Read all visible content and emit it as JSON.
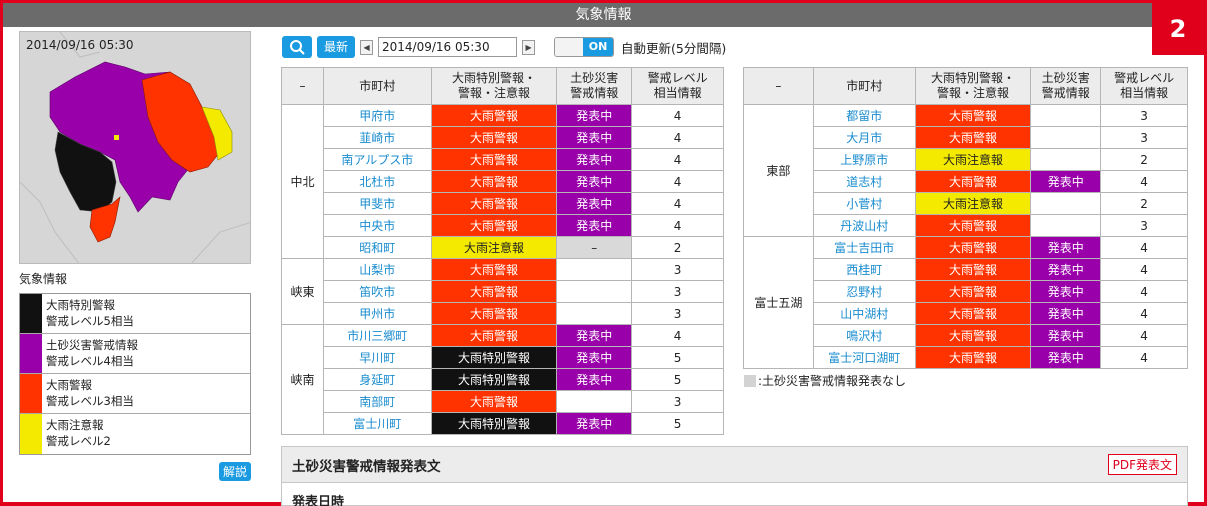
{
  "window": {
    "title": "気象情報",
    "badge": "2"
  },
  "map": {
    "timestamp": "2014/09/16 05:30"
  },
  "left": {
    "heading": "気象情報",
    "legend": [
      {
        "line1": "大雨特別警報",
        "line2": "警戒レベル5相当",
        "color": "#111111"
      },
      {
        "line1": "土砂災害警戒情報",
        "line2": "警戒レベル4相当",
        "color": "#9900aa"
      },
      {
        "line1": "大雨警報",
        "line2": "警戒レベル3相当",
        "color": "#ff3300"
      },
      {
        "line1": "大雨注意報",
        "line2": "警戒レベル2",
        "color": "#f3ea00"
      }
    ],
    "explain_label": "解説"
  },
  "toolbar": {
    "latest_label": "最新",
    "prev_glyph": "◀",
    "next_glyph": "▶",
    "datetime": "2014/09/16  05:30",
    "toggle_label": "ON",
    "auto_update_label": "自動更新(5分間隔)"
  },
  "headers": {
    "dash": "–",
    "city": "市町村",
    "warning_l1": "大雨特別警報・",
    "warning_l2": "警報・注意報",
    "landslide_l1": "土砂災害",
    "landslide_l2": "警戒情報",
    "level_l1": "警戒レベル",
    "level_l2": "相当情報"
  },
  "left_table": {
    "groups": [
      {
        "region": "中北",
        "rows": [
          {
            "city": "甲府市",
            "warning": "大雨警報",
            "wclass": "w-hw",
            "landslide": "発表中",
            "lclass": "l-on",
            "level": "4"
          },
          {
            "city": "韮崎市",
            "warning": "大雨警報",
            "wclass": "w-hw",
            "landslide": "発表中",
            "lclass": "l-on",
            "level": "4"
          },
          {
            "city": "南アルプス市",
            "warning": "大雨警報",
            "wclass": "w-hw",
            "landslide": "発表中",
            "lclass": "l-on",
            "level": "4"
          },
          {
            "city": "北杜市",
            "warning": "大雨警報",
            "wclass": "w-hw",
            "landslide": "発表中",
            "lclass": "l-on",
            "level": "4"
          },
          {
            "city": "甲斐市",
            "warning": "大雨警報",
            "wclass": "w-hw",
            "landslide": "発表中",
            "lclass": "l-on",
            "level": "4"
          },
          {
            "city": "中央市",
            "warning": "大雨警報",
            "wclass": "w-hw",
            "landslide": "発表中",
            "lclass": "l-on",
            "level": "4"
          },
          {
            "city": "昭和町",
            "warning": "大雨注意報",
            "wclass": "w-ad",
            "landslide": "–",
            "lclass": "l-na",
            "level": "2"
          }
        ]
      },
      {
        "region": "峡東",
        "rows": [
          {
            "city": "山梨市",
            "warning": "大雨警報",
            "wclass": "w-hw",
            "landslide": "",
            "lclass": "",
            "level": "3"
          },
          {
            "city": "笛吹市",
            "warning": "大雨警報",
            "wclass": "w-hw",
            "landslide": "",
            "lclass": "",
            "level": "3"
          },
          {
            "city": "甲州市",
            "warning": "大雨警報",
            "wclass": "w-hw",
            "landslide": "",
            "lclass": "",
            "level": "3"
          }
        ]
      },
      {
        "region": "峡南",
        "rows": [
          {
            "city": "市川三郷町",
            "warning": "大雨警報",
            "wclass": "w-hw",
            "landslide": "発表中",
            "lclass": "l-on",
            "level": "4"
          },
          {
            "city": "早川町",
            "warning": "大雨特別警報",
            "wclass": "w-sp",
            "landslide": "発表中",
            "lclass": "l-on",
            "level": "5"
          },
          {
            "city": "身延町",
            "warning": "大雨特別警報",
            "wclass": "w-sp",
            "landslide": "発表中",
            "lclass": "l-on",
            "level": "5"
          },
          {
            "city": "南部町",
            "warning": "大雨警報",
            "wclass": "w-hw",
            "landslide": "",
            "lclass": "",
            "level": "3"
          },
          {
            "city": "富士川町",
            "warning": "大雨特別警報",
            "wclass": "w-sp",
            "landslide": "発表中",
            "lclass": "l-on",
            "level": "5"
          }
        ]
      }
    ]
  },
  "right_table": {
    "groups": [
      {
        "region": "東部",
        "rows": [
          {
            "city": "都留市",
            "warning": "大雨警報",
            "wclass": "w-hw",
            "landslide": "",
            "lclass": "",
            "level": "3"
          },
          {
            "city": "大月市",
            "warning": "大雨警報",
            "wclass": "w-hw",
            "landslide": "",
            "lclass": "",
            "level": "3"
          },
          {
            "city": "上野原市",
            "warning": "大雨注意報",
            "wclass": "w-ad",
            "landslide": "",
            "lclass": "",
            "level": "2"
          },
          {
            "city": "道志村",
            "warning": "大雨警報",
            "wclass": "w-hw",
            "landslide": "発表中",
            "lclass": "l-on",
            "level": "4"
          },
          {
            "city": "小菅村",
            "warning": "大雨注意報",
            "wclass": "w-ad",
            "landslide": "",
            "lclass": "",
            "level": "2"
          },
          {
            "city": "丹波山村",
            "warning": "大雨警報",
            "wclass": "w-hw",
            "landslide": "",
            "lclass": "",
            "level": "3"
          }
        ]
      },
      {
        "region": "富士五湖",
        "rows": [
          {
            "city": "富士吉田市",
            "warning": "大雨警報",
            "wclass": "w-hw",
            "landslide": "発表中",
            "lclass": "l-on",
            "level": "4"
          },
          {
            "city": "西桂町",
            "warning": "大雨警報",
            "wclass": "w-hw",
            "landslide": "発表中",
            "lclass": "l-on",
            "level": "4"
          },
          {
            "city": "忍野村",
            "warning": "大雨警報",
            "wclass": "w-hw",
            "landslide": "発表中",
            "lclass": "l-on",
            "level": "4"
          },
          {
            "city": "山中湖村",
            "warning": "大雨警報",
            "wclass": "w-hw",
            "landslide": "発表中",
            "lclass": "l-on",
            "level": "4"
          },
          {
            "city": "鳴沢村",
            "warning": "大雨警報",
            "wclass": "w-hw",
            "landslide": "発表中",
            "lclass": "l-on",
            "level": "4"
          },
          {
            "city": "富士河口湖町",
            "warning": "大雨警報",
            "wclass": "w-hw",
            "landslide": "発表中",
            "lclass": "l-on",
            "level": "4"
          }
        ]
      }
    ]
  },
  "note": {
    "text": ":土砂災害警戒情報発表なし"
  },
  "bottom": {
    "title": "土砂災害警戒情報発表文",
    "pdf_label": "PDF発表文",
    "sub_label": "発表日時"
  },
  "colors": {
    "special": "#111111",
    "landslide": "#9900aa",
    "heavy": "#ff3300",
    "advisory": "#f3ea00",
    "accent": "#1a9ae0",
    "frame": "#e0001b"
  }
}
